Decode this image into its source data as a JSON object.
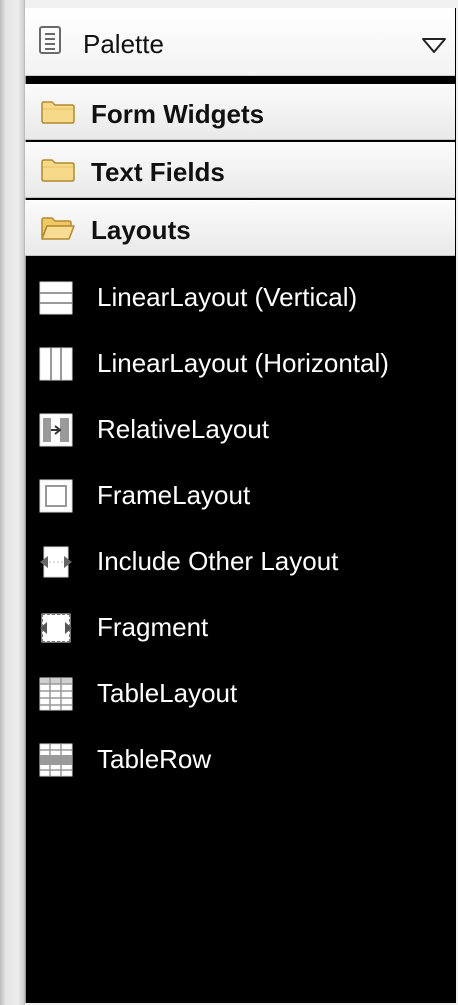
{
  "palette": {
    "title": "Palette",
    "drawers": [
      {
        "label": "Form Widgets",
        "state": "collapsed"
      },
      {
        "label": "Text Fields",
        "state": "collapsed"
      },
      {
        "label": "Layouts",
        "state": "expanded"
      }
    ],
    "layout_items": [
      {
        "label": "LinearLayout (Vertical)",
        "icon": "linear-layout-vertical-icon"
      },
      {
        "label": "LinearLayout (Horizontal)",
        "icon": "linear-layout-horizontal-icon"
      },
      {
        "label": "RelativeLayout",
        "icon": "relative-layout-icon"
      },
      {
        "label": "FrameLayout",
        "icon": "frame-layout-icon"
      },
      {
        "label": "Include Other Layout",
        "icon": "include-layout-icon"
      },
      {
        "label": "Fragment",
        "icon": "fragment-icon"
      },
      {
        "label": "TableLayout",
        "icon": "table-layout-icon"
      },
      {
        "label": "TableRow",
        "icon": "table-row-icon"
      }
    ]
  },
  "colors": {
    "list_background": "#000000",
    "list_text": "#ffffff",
    "header_background": "#f4f4f4",
    "folder": "#f5d27a"
  }
}
